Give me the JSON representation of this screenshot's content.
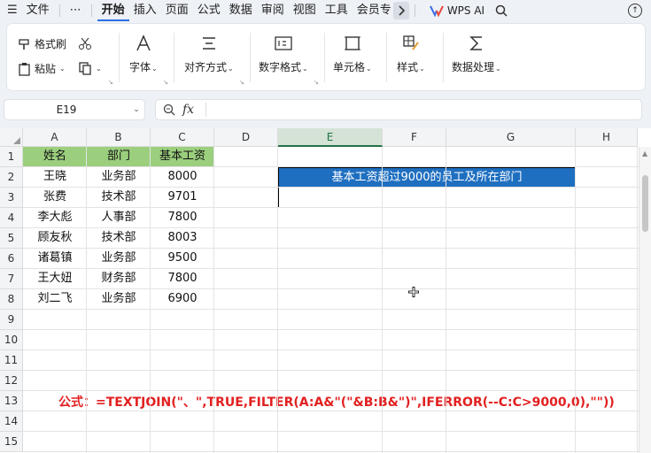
{
  "menu": {
    "items": [
      "文件",
      "⋯",
      "开始",
      "插入",
      "页面",
      "公式",
      "数据",
      "审阅",
      "视图",
      "工具",
      "会员专"
    ],
    "active": "开始",
    "wps_ai": "WPS AI"
  },
  "ribbon": {
    "format_painter": "格式刷",
    "paste": "粘贴",
    "font": "字体",
    "align": "对齐方式",
    "number_format": "数字格式",
    "cell": "单元格",
    "style": "样式",
    "data_process": "数据处理"
  },
  "formula_bar": {
    "name_box": "E19",
    "fx": "fx",
    "content": ""
  },
  "sheet": {
    "columns": [
      "A",
      "B",
      "C",
      "D",
      "E",
      "F",
      "G",
      "H"
    ],
    "selected_column": "E",
    "rows": [
      "1",
      "2",
      "3",
      "4",
      "5",
      "6",
      "7",
      "8",
      "9",
      "10",
      "11",
      "12",
      "13",
      "14",
      "15"
    ],
    "table_headers": [
      "姓名",
      "部门",
      "基本工资"
    ],
    "table_rows": [
      [
        "王晓",
        "业务部",
        "8000"
      ],
      [
        "张费",
        "技术部",
        "9701"
      ],
      [
        "李大彪",
        "人事部",
        "7800"
      ],
      [
        "顾友秋",
        "技术部",
        "8003"
      ],
      [
        "诸葛镇",
        "业务部",
        "9500"
      ],
      [
        "王大妞",
        "财务部",
        "7800"
      ],
      [
        "刘二飞",
        "业务部",
        "6900"
      ]
    ],
    "result_title": "基本工资超过9000的员工及所在部门",
    "result_value": "",
    "formula_note": "公式：=TEXTJOIN(\"、\",TRUE,FILTER(A:A&\"(\"&B:B&\")\",IFERROR(--C:C>9000,0),\"\"))"
  },
  "colors": {
    "header_green": "#9bcf7e",
    "title_blue": "#1f6fc0",
    "note_red": "#e22020"
  }
}
